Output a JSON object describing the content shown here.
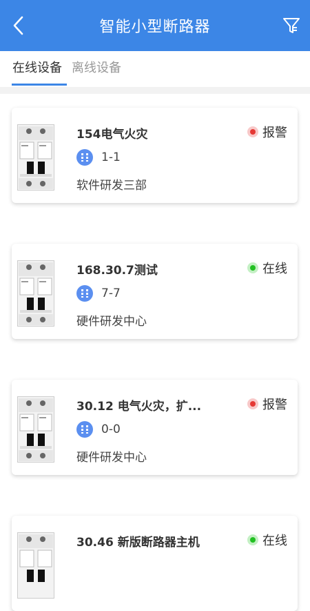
{
  "header": {
    "title": "智能小型断路器"
  },
  "tabs": [
    {
      "label": "在线设备"
    },
    {
      "label": "离线设备"
    }
  ],
  "devices": [
    {
      "name": "154电气火灾",
      "id": "1-1",
      "dept": "软件研发三部",
      "status": "报警"
    },
    {
      "name": "168.30.7测试",
      "id": "7-7",
      "dept": "硬件研发中心",
      "status": "在线"
    },
    {
      "name": "30.12  电气火灾，扩...",
      "id": "0-0",
      "dept": "硬件研发中心",
      "status": "报警"
    },
    {
      "name": "30.46 新版断路器主机",
      "id": "",
      "dept": "",
      "status": "在线"
    }
  ],
  "colors": {
    "primary": "#3c86e6",
    "alarm": "#e53935",
    "online": "#22c022"
  }
}
